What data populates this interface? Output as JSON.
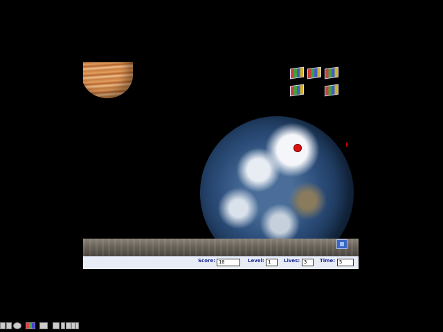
{
  "game": {
    "score_label": "Score:",
    "score_value": "10",
    "level_label": "Level:",
    "level_value": "1",
    "lives_label": "Lives:",
    "lives_value": "3",
    "time_label": "Time:",
    "time_value": "5"
  },
  "scene": {
    "background_color": "#000000",
    "target_color": "#e01010",
    "planet_icon": "jupiter-icon",
    "earth_icon": "earth-icon",
    "brick_icon": "windows-flag-icon",
    "brick_count": 5,
    "paddle_icon": "finder-icon"
  },
  "taskbar": {
    "icons": [
      "dock-icon",
      "launcher-icon",
      "clock-icon",
      "color-icon",
      "control-icon",
      "sound-icon",
      "arrow-icon",
      "folder-icon",
      "disk-icon",
      "stripe-icon"
    ]
  }
}
